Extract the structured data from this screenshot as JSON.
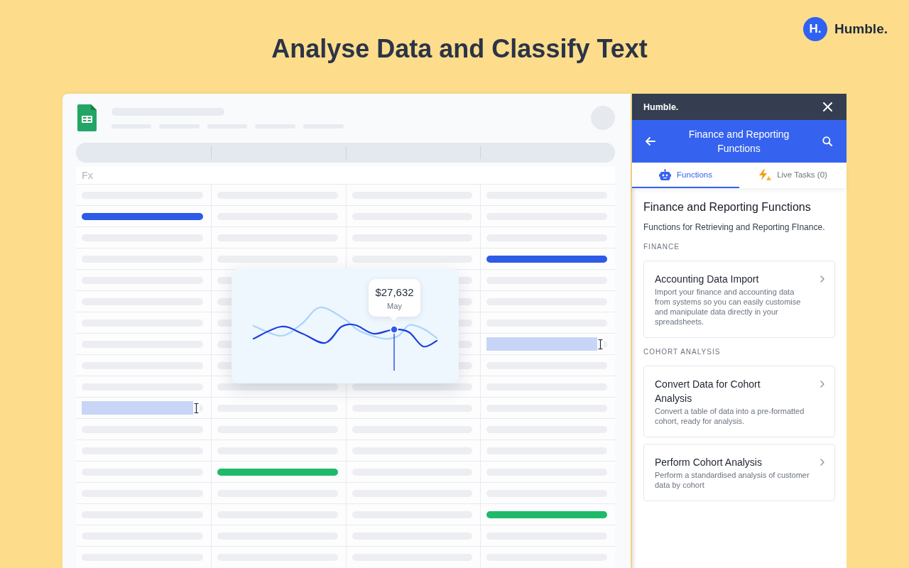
{
  "title": "Analyse Data and Classify Text",
  "brand": {
    "mark": "H.",
    "name": "Humble."
  },
  "sheet": {
    "formula_label": "Fx",
    "rows": [
      [
        {
          "kind": "placeholder"
        },
        {
          "kind": "placeholder"
        },
        {
          "kind": "placeholder"
        },
        {
          "kind": "placeholder"
        }
      ],
      [
        {
          "kind": "bar",
          "color": "#2d5be6"
        },
        {
          "kind": "placeholder"
        },
        {
          "kind": "placeholder"
        },
        {
          "kind": "placeholder"
        }
      ],
      [
        {
          "kind": "placeholder"
        },
        {
          "kind": "placeholder"
        },
        {
          "kind": "placeholder"
        },
        {
          "kind": "placeholder"
        }
      ],
      [
        {
          "kind": "placeholder"
        },
        {
          "kind": "placeholder"
        },
        {
          "kind": "placeholder"
        },
        {
          "kind": "bar",
          "color": "#2d5be6"
        }
      ],
      [
        {
          "kind": "placeholder"
        },
        {
          "kind": "placeholder"
        },
        {
          "kind": "placeholder"
        },
        {
          "kind": "placeholder"
        }
      ],
      [
        {
          "kind": "placeholder"
        },
        {
          "kind": "placeholder"
        },
        {
          "kind": "placeholder"
        },
        {
          "kind": "placeholder"
        }
      ],
      [
        {
          "kind": "placeholder"
        },
        {
          "kind": "placeholder"
        },
        {
          "kind": "placeholder"
        },
        {
          "kind": "placeholder"
        }
      ],
      [
        {
          "kind": "placeholder"
        },
        {
          "kind": "placeholder"
        },
        {
          "kind": "placeholder"
        },
        {
          "kind": "selection"
        }
      ],
      [
        {
          "kind": "placeholder"
        },
        {
          "kind": "placeholder"
        },
        {
          "kind": "placeholder"
        },
        {
          "kind": "placeholder"
        }
      ],
      [
        {
          "kind": "placeholder"
        },
        {
          "kind": "placeholder"
        },
        {
          "kind": "placeholder"
        },
        {
          "kind": "placeholder"
        }
      ],
      [
        {
          "kind": "selection"
        },
        {
          "kind": "placeholder"
        },
        {
          "kind": "placeholder"
        },
        {
          "kind": "placeholder"
        }
      ],
      [
        {
          "kind": "placeholder"
        },
        {
          "kind": "placeholder"
        },
        {
          "kind": "placeholder"
        },
        {
          "kind": "placeholder"
        }
      ],
      [
        {
          "kind": "placeholder"
        },
        {
          "kind": "placeholder"
        },
        {
          "kind": "placeholder"
        },
        {
          "kind": "placeholder"
        }
      ],
      [
        {
          "kind": "placeholder"
        },
        {
          "kind": "bar",
          "color": "#1fb96a"
        },
        {
          "kind": "placeholder"
        },
        {
          "kind": "placeholder"
        }
      ],
      [
        {
          "kind": "placeholder"
        },
        {
          "kind": "placeholder"
        },
        {
          "kind": "placeholder"
        },
        {
          "kind": "placeholder"
        }
      ],
      [
        {
          "kind": "placeholder"
        },
        {
          "kind": "placeholder"
        },
        {
          "kind": "placeholder"
        },
        {
          "kind": "bar",
          "color": "#1fb96a"
        }
      ],
      [
        {
          "kind": "placeholder"
        },
        {
          "kind": "placeholder"
        },
        {
          "kind": "placeholder"
        },
        {
          "kind": "placeholder"
        }
      ],
      [
        {
          "kind": "placeholder"
        },
        {
          "kind": "placeholder"
        },
        {
          "kind": "placeholder"
        },
        {
          "kind": "placeholder"
        }
      ]
    ]
  },
  "chart_popup": {
    "value": "$27,632",
    "label": "May"
  },
  "panel": {
    "brand": "Humble.",
    "header_title": "Finance and Reporting Functions",
    "tabs": [
      {
        "label": "Functions",
        "selected": true
      },
      {
        "label": "Live Tasks (0)",
        "selected": false
      }
    ],
    "heading": "Finance and Reporting Functions",
    "subtitle": "Functions for Retrieving and Reporting FInance.",
    "sections": [
      {
        "label": "FINANCE",
        "cards": [
          {
            "title": "Accounting Data Import",
            "description": "Import your finance and accounting data from systems so you can easily customise and manipulate data directly in your spreadsheets."
          }
        ]
      },
      {
        "label": "COHORT ANALYSIS",
        "cards": [
          {
            "title": "Convert Data for Cohort Analysis",
            "description": "Convert a table of data into a pre-formatted cohort, ready for analysis."
          },
          {
            "title": "Perform Cohort Analysis",
            "description": "Perform a standardised analysis of customer data by cohort"
          }
        ]
      }
    ]
  }
}
